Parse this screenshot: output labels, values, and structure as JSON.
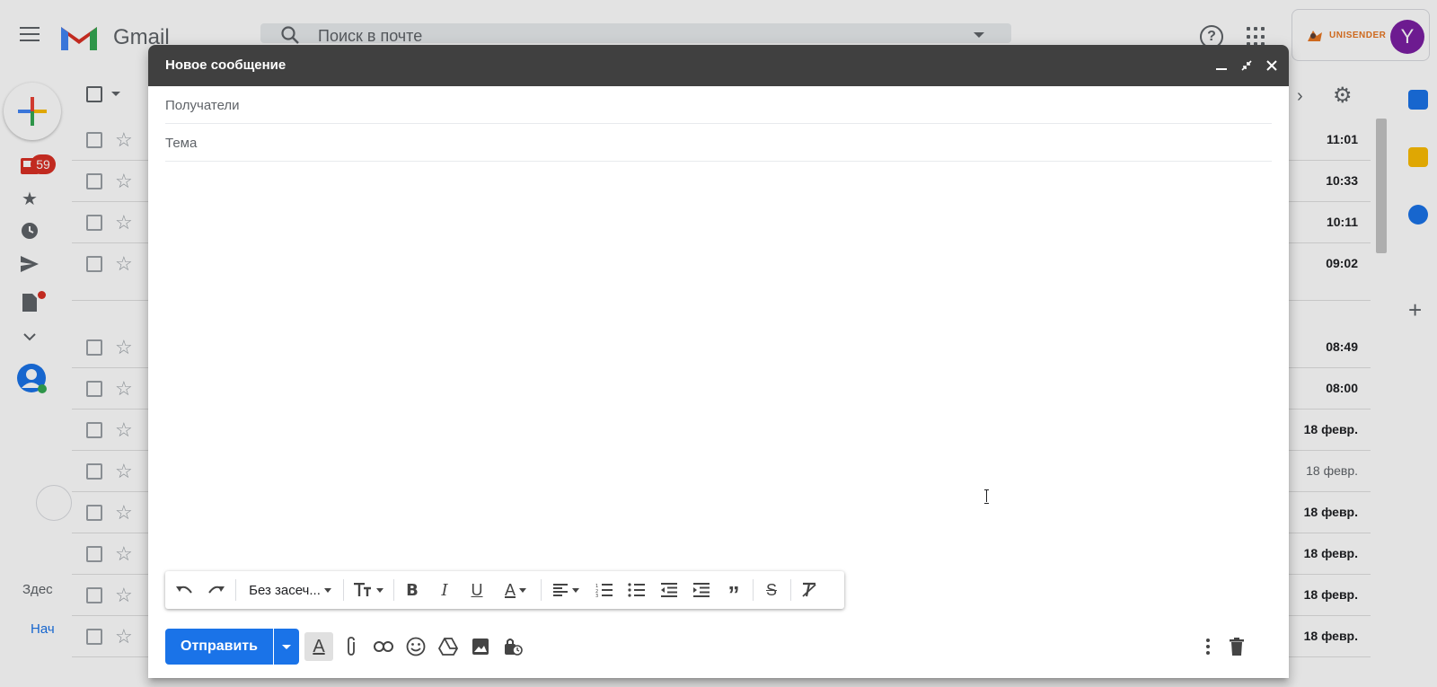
{
  "app": {
    "logo_text": "Gmail",
    "search_placeholder": "Поиск в почте",
    "account_initial": "Y",
    "extension_label": "UNISENDER",
    "unread_count": "59",
    "sidebar_text_1": "Здес",
    "sidebar_link_1": "Нач"
  },
  "mail_times": [
    {
      "time": "11:01",
      "read": false
    },
    {
      "time": "10:33",
      "read": false
    },
    {
      "time": "10:11",
      "read": false
    },
    {
      "time": "09:02",
      "read": false
    },
    {
      "time": "08:49",
      "read": false
    },
    {
      "time": "08:00",
      "read": false
    },
    {
      "time": "18 февр.",
      "read": false
    },
    {
      "time": "18 февр.",
      "read": true
    },
    {
      "time": "18 февр.",
      "read": false
    },
    {
      "time": "18 февр.",
      "read": false
    },
    {
      "time": "18 февр.",
      "read": false
    },
    {
      "time": "18 февр.",
      "read": false
    }
  ],
  "compose": {
    "title": "Новое сообщение",
    "recipients_placeholder": "Получатели",
    "subject_placeholder": "Тема",
    "font_select": "Без засеч...",
    "send_label": "Отправить"
  },
  "colors": {
    "accent": "#1a73e8",
    "header": "#404040",
    "badge": "#d93025"
  }
}
